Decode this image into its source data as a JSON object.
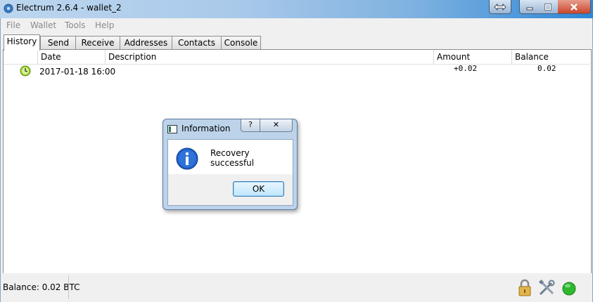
{
  "window": {
    "title": "Electrum 2.6.4  -  wallet_2"
  },
  "menu": [
    "File",
    "Wallet",
    "Tools",
    "Help"
  ],
  "tabs": [
    "History",
    "Send",
    "Receive",
    "Addresses",
    "Contacts",
    "Console"
  ],
  "active_tab": "History",
  "history": {
    "columns": [
      "",
      "Date",
      "Description",
      "Amount",
      "Balance"
    ],
    "rows": [
      {
        "status_icon": "clock-icon",
        "date": "2017-01-18 16:00",
        "description": "",
        "amount": "+0.02",
        "balance": "0.02"
      }
    ]
  },
  "dialog": {
    "title": "Information",
    "help_label": "?",
    "close_label": "✕",
    "message": "Recovery successful",
    "ok_label": "OK",
    "icon": "information-icon"
  },
  "statusbar": {
    "balance_text": "Balance: 0.02 BTC",
    "icons": [
      "lock-icon",
      "preferences-icon",
      "network-status-icon"
    ],
    "network_status_color": "#2eb82e"
  }
}
